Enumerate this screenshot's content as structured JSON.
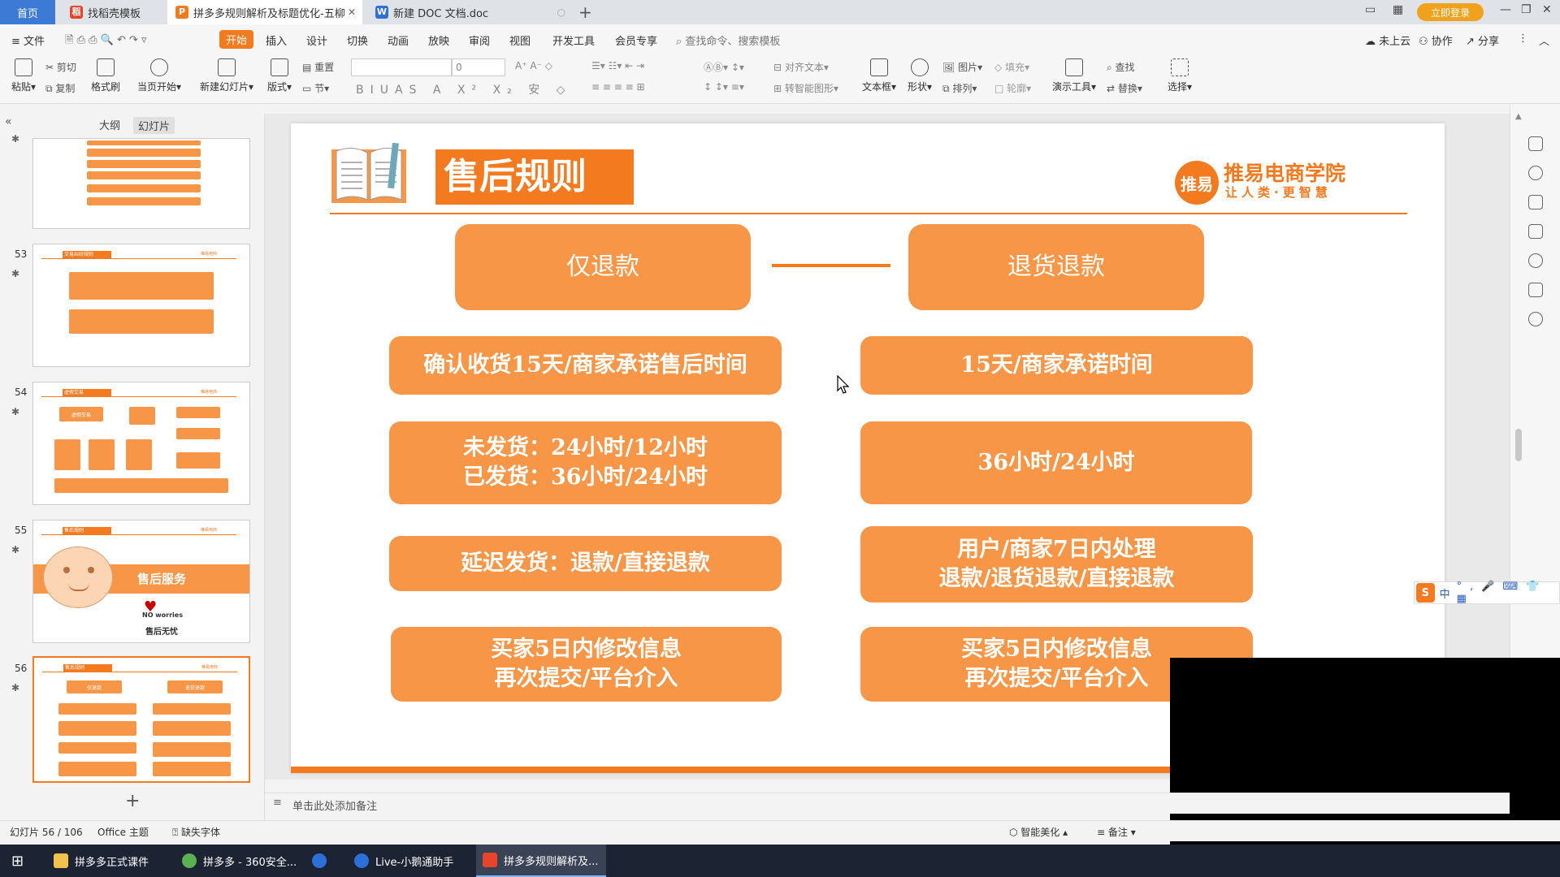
{
  "titlebar": {
    "tabs": [
      {
        "label": "首页"
      },
      {
        "label": "找稻壳模板"
      },
      {
        "label": "拼多多规则解析及标题优化-五柳"
      },
      {
        "label": "新建 DOC 文档.doc"
      }
    ],
    "login": "立即登录"
  },
  "menubar": {
    "file": "文件",
    "items": [
      "开始",
      "插入",
      "设计",
      "切换",
      "动画",
      "放映",
      "审阅",
      "视图",
      "开发工具",
      "会员专享"
    ],
    "search": "查找命令、搜索模板",
    "cloud": "未上云",
    "collab": "协作",
    "share": "分享"
  },
  "ribbon": {
    "paste": "粘贴",
    "cut": "剪切",
    "copy": "复制",
    "format_painter": "格式刷",
    "start_from_current": "当页开始",
    "new_slide": "新建幻灯片",
    "layout": "版式",
    "reset": "重置",
    "section": "节",
    "font_size": "0",
    "align_text": "对齐文本",
    "smartart": "转智能图形",
    "textbox": "文本框",
    "shape": "形状",
    "picture": "图片",
    "fill": "填充",
    "arrange": "排列",
    "outline": "轮廓",
    "presenter_tools": "演示工具",
    "find": "查找",
    "replace": "替换",
    "select": "选择"
  },
  "leftpanel": {
    "tab_outline": "大纲",
    "tab_slides": "幻灯片",
    "thumbs": [
      {
        "num": "53",
        "title": "交易纠纷规则"
      },
      {
        "num": "54",
        "title": "虚假交易",
        "center": "虚假交易"
      },
      {
        "num": "55",
        "title": "售后规则",
        "banner": "售后服务",
        "caption": "售后无忧",
        "no_worries": "NO worries"
      },
      {
        "num": "56",
        "title": "售后规则",
        "left": "仅退款",
        "right": "退货退款"
      }
    ]
  },
  "slide": {
    "title": "售后规则",
    "brand_name": "推易电商学院",
    "brand_slogan": "让人类·更智慧",
    "brand_mark": "推易",
    "left_header": "仅退款",
    "right_header": "退货退款",
    "left_rows": [
      "确认收货15天/商家承诺售后时间",
      "未发货：24小时/12小时\n已发货：36小时/24小时",
      "延迟发货：退款/直接退款",
      "买家5日内修改信息\n再次提交/平台介入"
    ],
    "right_rows": [
      "15天/商家承诺时间",
      "36小时/24小时",
      "用户/商家7日内处理\n退款/退货退款/直接退款",
      "买家5日内修改信息\n再次提交/平台介入"
    ]
  },
  "notes_placeholder": "单击此处添加备注",
  "status": {
    "slide_pos": "幻灯片 56 / 106",
    "theme": "Office 主题",
    "missing_font": "缺失字体",
    "beautify": "智能美化",
    "notes": "备注"
  },
  "taskbar": {
    "items": [
      "拼多多正式课件",
      "拼多多 - 360安全...",
      "Live-小鹅通助手",
      "拼多多规则解析及..."
    ]
  },
  "ime": {
    "label": "中"
  },
  "colors": {
    "accent": "#f37a1f",
    "box": "#f79646",
    "home_tab": "#3d7ad6"
  }
}
